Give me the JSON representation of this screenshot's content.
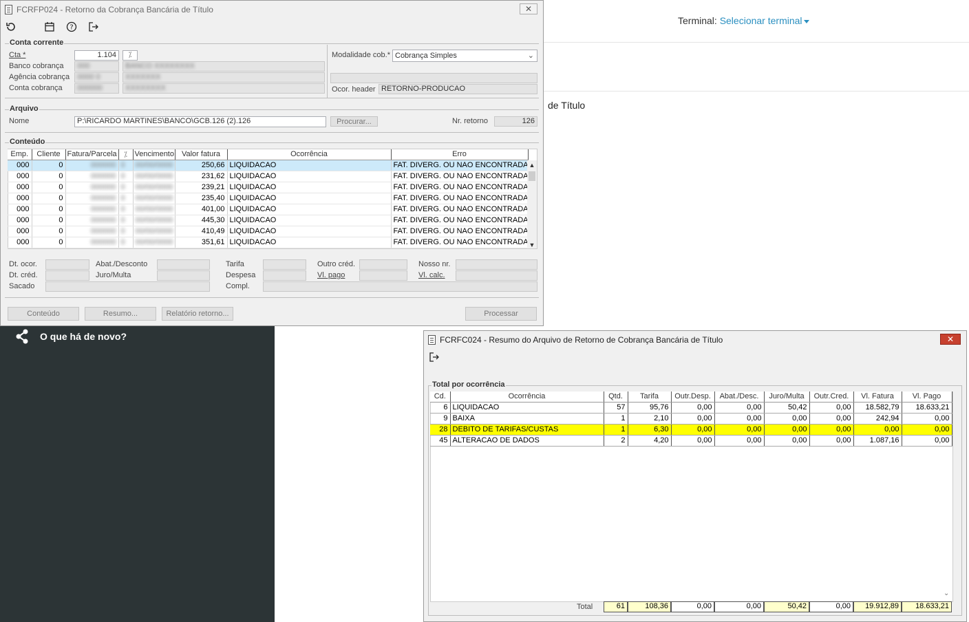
{
  "background": {
    "terminal_label": "Terminal:",
    "terminal_link": "Selecionar terminal",
    "titulo_fragment": "de Título",
    "news_label": "O que há de novo?"
  },
  "main_window": {
    "title": "FCRFP024 - Retorno da Cobrança Bancária de Título",
    "conta_corrente": {
      "group_label": "Conta corrente",
      "cta_label": "Cta *",
      "cta_value": "1.104",
      "banco_label": "Banco cobrança",
      "agencia_label": "Agência cobrança",
      "conta_label": "Conta cobrança",
      "modalidade_label": "Modalidade cob.*",
      "modalidade_value": "Cobrança Simples",
      "ocor_header_label": "Ocor. header",
      "ocor_header_value": "RETORNO-PRODUCAO"
    },
    "arquivo": {
      "group_label": "Arquivo",
      "nome_label": "Nome",
      "nome_value": "P:\\RICARDO MARTINES\\BANCO\\GCB.126 (2).126",
      "procurar_label": "Procurar...",
      "nr_retorno_label": "Nr. retorno",
      "nr_retorno_value": "126"
    },
    "conteudo": {
      "group_label": "Conteúdo",
      "columns": [
        "Emp.",
        "Cliente",
        "Fatura/Parcela",
        "Vencimento",
        "Valor fatura",
        "Ocorrência",
        "Erro"
      ],
      "rows": [
        {
          "emp": "000",
          "cliente": "0",
          "valor": "250,66",
          "ocorrencia": "LIQUIDACAO",
          "erro": "FAT. DIVERG. OU NAO ENCONTRADA"
        },
        {
          "emp": "000",
          "cliente": "0",
          "valor": "231,62",
          "ocorrencia": "LIQUIDACAO",
          "erro": "FAT. DIVERG. OU NAO ENCONTRADA"
        },
        {
          "emp": "000",
          "cliente": "0",
          "valor": "239,21",
          "ocorrencia": "LIQUIDACAO",
          "erro": "FAT. DIVERG. OU NAO ENCONTRADA"
        },
        {
          "emp": "000",
          "cliente": "0",
          "valor": "235,40",
          "ocorrencia": "LIQUIDACAO",
          "erro": "FAT. DIVERG. OU NAO ENCONTRADA"
        },
        {
          "emp": "000",
          "cliente": "0",
          "valor": "401,00",
          "ocorrencia": "LIQUIDACAO",
          "erro": "FAT. DIVERG. OU NAO ENCONTRADA"
        },
        {
          "emp": "000",
          "cliente": "0",
          "valor": "445,30",
          "ocorrencia": "LIQUIDACAO",
          "erro": "FAT. DIVERG. OU NAO ENCONTRADA"
        },
        {
          "emp": "000",
          "cliente": "0",
          "valor": "410,49",
          "ocorrencia": "LIQUIDACAO",
          "erro": "FAT. DIVERG. OU NAO ENCONTRADA"
        },
        {
          "emp": "000",
          "cliente": "0",
          "valor": "351,61",
          "ocorrencia": "LIQUIDACAO",
          "erro": "FAT. DIVERG. OU NAO ENCONTRADA"
        }
      ]
    },
    "details": {
      "dt_ocor": "Dt. ocor.",
      "dt_cred": "Dt. créd.",
      "sacado": "Sacado",
      "abat_desconto": "Abat./Desconto",
      "juro_multa": "Juro/Multa",
      "tarifa": "Tarifa",
      "despesa": "Despesa",
      "compl": "Compl.",
      "outro_cred": "Outro créd.",
      "vl_pago": "Vl. pago",
      "nosso_nr": "Nosso nr.",
      "vl_calc": "Vl. calc."
    },
    "buttons": {
      "conteudo": "Conteúdo",
      "resumo": "Resumo...",
      "relatorio": "Relatório retorno...",
      "processar": "Processar"
    }
  },
  "summary_window": {
    "title": "FCRFC024 - Resumo do Arquivo de Retorno de Cobrança Bancária de Título",
    "group_label": "Total por ocorrência",
    "columns": [
      "Cd.",
      "Ocorrência",
      "Qtd.",
      "Tarifa",
      "Outr.Desp.",
      "Abat./Desc.",
      "Juro/Multa",
      "Outr.Cred.",
      "Vl. Fatura",
      "Vl. Pago"
    ],
    "rows": [
      [
        "6",
        "LIQUIDACAO",
        "57",
        "95,76",
        "0,00",
        "0,00",
        "50,42",
        "0,00",
        "18.582,79",
        "18.633,21"
      ],
      [
        "9",
        "BAIXA",
        "1",
        "2,10",
        "0,00",
        "0,00",
        "0,00",
        "0,00",
        "242,94",
        "0,00"
      ],
      [
        "28",
        "DEBITO DE TARIFAS/CUSTAS",
        "1",
        "6,30",
        "0,00",
        "0,00",
        "0,00",
        "0,00",
        "0,00",
        "0,00"
      ],
      [
        "45",
        "ALTERACAO DE DADOS",
        "2",
        "4,20",
        "0,00",
        "0,00",
        "0,00",
        "0,00",
        "1.087,16",
        "0,00"
      ]
    ],
    "highlight_row": 2,
    "highlight_color": "#ffff00",
    "total_label": "Total",
    "totals": [
      "61",
      "108,36",
      "0,00",
      "0,00",
      "50,42",
      "0,00",
      "19.912,89",
      "18.633,21"
    ]
  }
}
